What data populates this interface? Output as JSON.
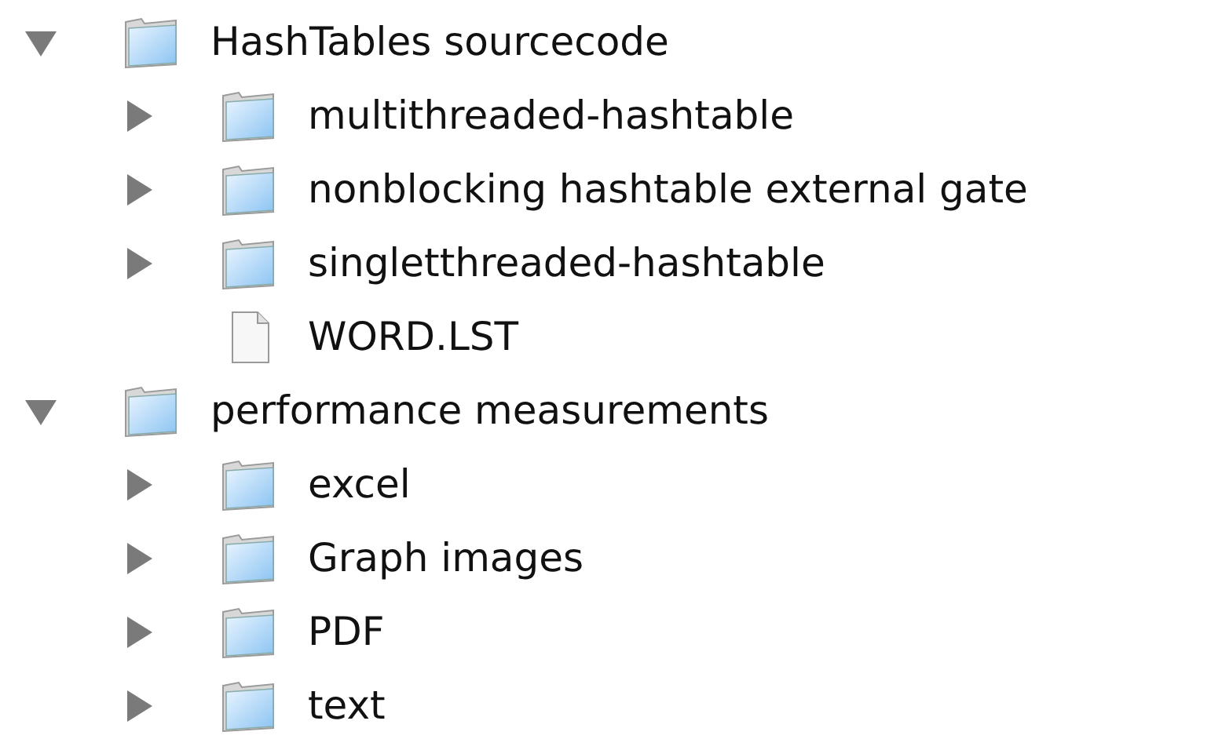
{
  "tree": [
    {
      "label": "HashTables sourcecode",
      "kind": "folder",
      "expanded": true,
      "children": [
        {
          "label": "multithreaded-hashtable",
          "kind": "folder",
          "expanded": false
        },
        {
          "label": "nonblocking hashtable external gate",
          "kind": "folder",
          "expanded": false
        },
        {
          "label": "singletthreaded-hashtable",
          "kind": "folder",
          "expanded": false
        },
        {
          "label": "WORD.LST",
          "kind": "file"
        }
      ]
    },
    {
      "label": "performance measurements",
      "kind": "folder",
      "expanded": true,
      "children": [
        {
          "label": "excel",
          "kind": "folder",
          "expanded": false
        },
        {
          "label": "Graph images",
          "kind": "folder",
          "expanded": false
        },
        {
          "label": "PDF",
          "kind": "folder",
          "expanded": false
        },
        {
          "label": "text",
          "kind": "folder",
          "expanded": false
        }
      ]
    }
  ]
}
